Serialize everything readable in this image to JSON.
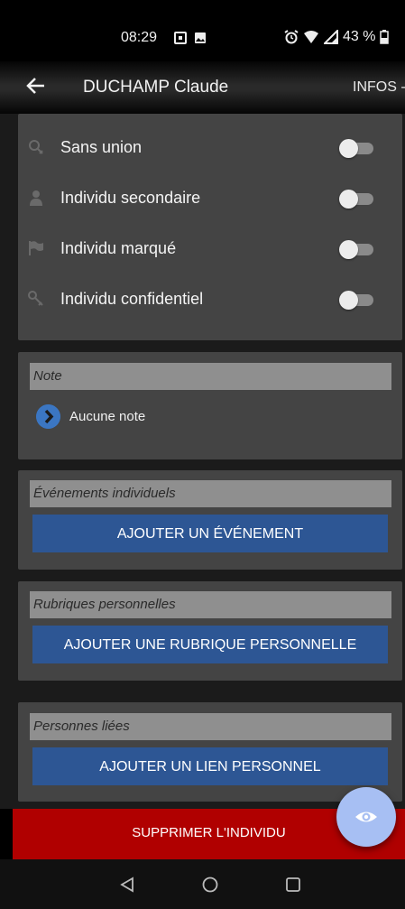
{
  "status_bar": {
    "time": "08:29",
    "battery": "43 %"
  },
  "app_bar": {
    "title": "DUCHAMP Claude",
    "tab_label": "INFOS -"
  },
  "toggles": [
    {
      "label": "Sans union",
      "icon": "ring-icon",
      "on": false
    },
    {
      "label": "Individu secondaire",
      "icon": "person-icon",
      "on": false
    },
    {
      "label": "Individu marqué",
      "icon": "flag-icon",
      "on": false
    },
    {
      "label": "Individu confidentiel",
      "icon": "key-icon",
      "on": false
    }
  ],
  "note": {
    "header": "Note",
    "value": "Aucune note"
  },
  "events": {
    "header": "Événements individuels",
    "button": "AJOUTER UN ÉVÉNEMENT"
  },
  "rubrics": {
    "header": "Rubriques personnelles",
    "button": "AJOUTER UNE RUBRIQUE PERSONNELLE"
  },
  "links": {
    "header": "Personnes liées",
    "button": "AJOUTER UN LIEN PERSONNEL"
  },
  "delete_button": "SUPPRIMER L'INDIVIDU",
  "colors": {
    "accent_blue": "#2d5694",
    "delete_red": "#b00000",
    "fab": "#a7bff3"
  }
}
